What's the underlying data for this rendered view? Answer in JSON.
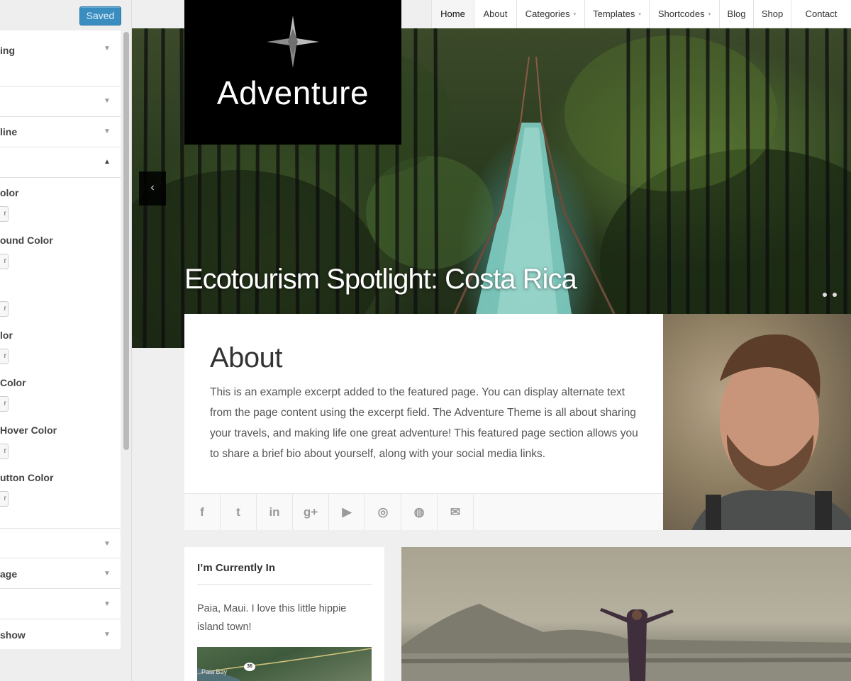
{
  "customizer": {
    "saved_label": "Saved",
    "sections_top": [
      {
        "label": "ing"
      },
      {
        "label": ""
      },
      {
        "label": "line"
      },
      {
        "label": ""
      }
    ],
    "controls": [
      {
        "label": "olor"
      },
      {
        "label": "ound Color"
      },
      {
        "label": ""
      },
      {
        "label": "lor"
      },
      {
        "label": "Color"
      },
      {
        "label": "Hover Color"
      },
      {
        "label": "utton Color"
      }
    ],
    "picker_glyph": "r",
    "sections_bottom": [
      {
        "label": ""
      },
      {
        "label": "age"
      },
      {
        "label": ""
      },
      {
        "label": "show"
      }
    ]
  },
  "site": {
    "logo_text": "Adventure",
    "nav": [
      {
        "label": "Home",
        "active": true
      },
      {
        "label": "About"
      },
      {
        "label": "Categories",
        "dropdown": true
      },
      {
        "label": "Templates",
        "dropdown": true
      },
      {
        "label": "Shortcodes",
        "dropdown": true
      },
      {
        "label": "Blog"
      },
      {
        "label": "Shop"
      },
      {
        "label": "Contact"
      }
    ],
    "caret": "▾",
    "hero": {
      "title": "Ecotourism Spotlight: Costa Rica",
      "prev_icon": "‹"
    },
    "about": {
      "title": "About",
      "text": "This is an example excerpt added to the featured page. You can display alternate text from the page content using the excerpt field. The Adventure Theme is all about sharing your travels, and making life one great adventure! This featured page section allows you to share a brief bio about yourself, along with your social media links."
    },
    "social": [
      {
        "icon": "facebook-icon",
        "glyph": "f"
      },
      {
        "icon": "twitter-icon",
        "glyph": "t"
      },
      {
        "icon": "linkedin-icon",
        "glyph": "in"
      },
      {
        "icon": "google-plus-icon",
        "glyph": "g+"
      },
      {
        "icon": "youtube-icon",
        "glyph": "▶"
      },
      {
        "icon": "github-icon",
        "glyph": "◎"
      },
      {
        "icon": "dribbble-icon",
        "glyph": "◍"
      },
      {
        "icon": "email-icon",
        "glyph": "✉"
      }
    ],
    "widget": {
      "title": "I’m Currently In",
      "text": "Paia, Maui. I love this little hippie island town!",
      "map_label": "Paia Bay",
      "map_road": "36"
    }
  }
}
